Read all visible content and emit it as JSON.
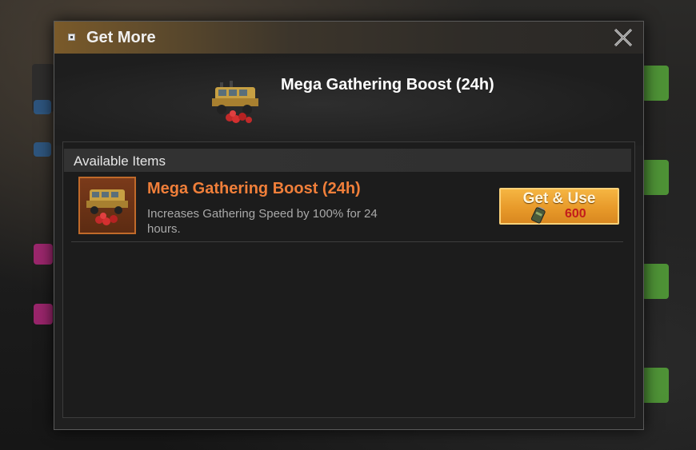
{
  "dialog": {
    "title": "Get More",
    "hero_title": "Mega Gathering Boost (24h)"
  },
  "available_items": {
    "header": "Available Items",
    "items": [
      {
        "name": "Mega Gathering Boost (24h)",
        "description": "Increases Gathering Speed by 100% for 24 hours.",
        "button_label": "Get & Use",
        "cost": "600",
        "cost_icon": "battery-icon"
      }
    ]
  },
  "colors": {
    "item_name": "#f07f3a",
    "button": "#e89a2a",
    "cost": "#c21c1c"
  }
}
